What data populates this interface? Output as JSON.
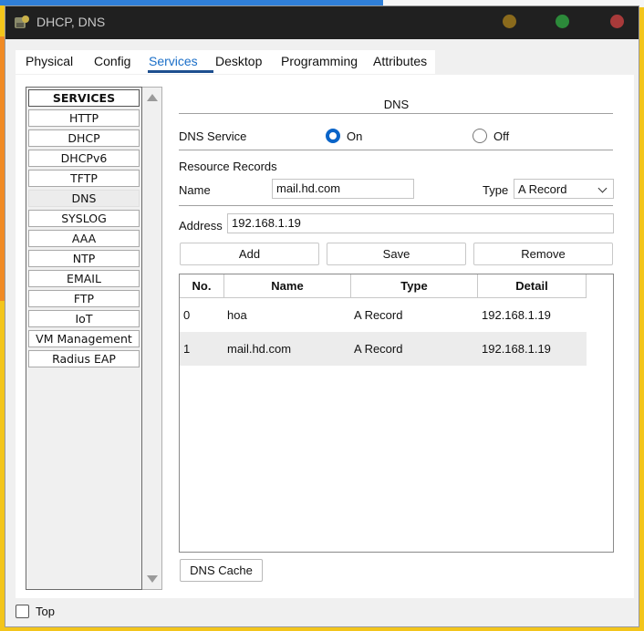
{
  "window": {
    "title": "DHCP, DNS"
  },
  "tabs": [
    "Physical",
    "Config",
    "Services",
    "Desktop",
    "Programming",
    "Attributes"
  ],
  "services": {
    "header": "SERVICES",
    "items": [
      "HTTP",
      "DHCP",
      "DHCPv6",
      "TFTP",
      "DNS",
      "SYSLOG",
      "AAA",
      "NTP",
      "EMAIL",
      "FTP",
      "IoT",
      "VM Management",
      "Radius EAP"
    ],
    "selected": "DNS"
  },
  "dns": {
    "title": "DNS",
    "service_label": "DNS Service",
    "on_label": "On",
    "off_label": "Off",
    "service_state": "On",
    "resource_records_label": "Resource Records",
    "name_label": "Name",
    "name_value": "mail.hd.com",
    "type_label": "Type",
    "type_value": "A Record",
    "address_label": "Address",
    "address_value": "192.168.1.19",
    "add_button": "Add",
    "save_button": "Save",
    "remove_button": "Remove",
    "table": {
      "columns": [
        "No.",
        "Name",
        "Type",
        "Detail"
      ],
      "rows": [
        [
          "0",
          "hoa",
          "A Record",
          "192.168.1.19"
        ],
        [
          "1",
          "mail.hd.com",
          "A Record",
          "192.168.1.19"
        ]
      ]
    },
    "cache_button": "DNS Cache"
  },
  "footer": {
    "top_label": "Top",
    "top_checked": false
  },
  "colors": {
    "accent": "#0a64c8",
    "tab_active": "#1b6fc8",
    "titlebar": "#202020",
    "selected_row": "#ececec"
  }
}
